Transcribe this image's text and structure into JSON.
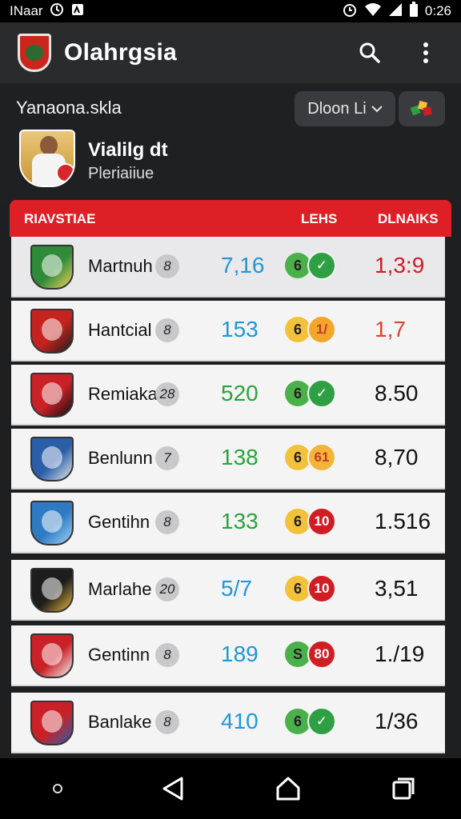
{
  "status_bar": {
    "carrier": "INaar",
    "time": "0:26",
    "icons": [
      "sync-icon",
      "alarm-icon",
      "wifi-icon",
      "signal-icon",
      "battery-icon"
    ]
  },
  "app_bar": {
    "title": "Olahrgsia",
    "icons": [
      "search-icon",
      "more-vert-icon"
    ]
  },
  "subheader": {
    "title": "Yanaona.skla",
    "dropdown_label": "Dloon Li",
    "player_name": "Vialilg dt",
    "player_subtitle": "Pleriaiiue"
  },
  "table": {
    "headers": [
      "RIAVSTIAE",
      "LEHS",
      "DLNAIKS"
    ],
    "rows": [
      {
        "team": "Martnuh",
        "rank": "8",
        "score": "7,16",
        "score_color": "#2196d8",
        "dot_a": "6",
        "dot_a_color": "#49b04a",
        "dot_b": "✓",
        "dot_b_color": "#2ea043",
        "result": "1,3:9",
        "result_color": "#d01d24",
        "crest": [
          "#2f8a39",
          "#f0d25a"
        ]
      },
      {
        "team": "Hantcial",
        "rank": "8",
        "score": "153",
        "score_color": "#2196d8",
        "dot_a": "6",
        "dot_a_color": "#f3c13a",
        "dot_b": "1/",
        "dot_b_color": "#f3a72a",
        "result": "1,7",
        "result_color": "#e0442b",
        "crest": [
          "#c5231f",
          "#1d1d1d"
        ]
      },
      {
        "team": "Remiaka",
        "rank": "28",
        "score": "520",
        "score_color": "#2aa33a",
        "dot_a": "6",
        "dot_a_color": "#49b04a",
        "dot_b": "✓",
        "dot_b_color": "#2ea043",
        "result": "8.50",
        "result_color": "#111111",
        "crest": [
          "#c92127",
          "#111111"
        ]
      },
      {
        "team": "Benlunn",
        "rank": "7",
        "score": "138",
        "score_color": "#2aa33a",
        "dot_a": "6",
        "dot_a_color": "#f3c13a",
        "dot_b": "61",
        "dot_b_color": "#f3b43a",
        "result": "8,70",
        "result_color": "#111111",
        "crest": [
          "#2a5ea8",
          "#e6e6e6"
        ]
      },
      {
        "team": "Gentihn",
        "rank": "8",
        "score": "133",
        "score_color": "#2aa33a",
        "dot_a": "6",
        "dot_a_color": "#f3c13a",
        "dot_b": "10",
        "dot_b_color": "#d01d24",
        "result": "1.516",
        "result_color": "#111111",
        "crest": [
          "#2e7bc4",
          "#9ed3f3"
        ]
      },
      {
        "team": "Marlahe",
        "rank": "20",
        "score": "5/7",
        "score_color": "#2196d8",
        "dot_a": "6",
        "dot_a_color": "#f3c13a",
        "dot_b": "10",
        "dot_b_color": "#d01d24",
        "result": "3,51",
        "result_color": "#111111",
        "crest": [
          "#1d1d1d",
          "#e8b43a"
        ]
      },
      {
        "team": "Gentinn",
        "rank": "8",
        "score": "189",
        "score_color": "#2196d8",
        "dot_a": "S",
        "dot_a_color": "#49b04a",
        "dot_b": "80",
        "dot_b_color": "#d01d24",
        "result": "1./19",
        "result_color": "#111111",
        "crest": [
          "#c92127",
          "#f2f2f2"
        ]
      },
      {
        "team": "Banlake",
        "rank": "8",
        "score": "410",
        "score_color": "#2196d8",
        "dot_a": "6",
        "dot_a_color": "#49b04a",
        "dot_b": "✓",
        "dot_b_color": "#2ea043",
        "result": "1/36",
        "result_color": "#111111",
        "crest": [
          "#c92127",
          "#2a5ea8"
        ]
      }
    ]
  },
  "nav_bar": {
    "icons": [
      "recents-dot-icon",
      "back-icon",
      "home-icon",
      "overview-icon"
    ]
  },
  "colors": {
    "accent_red": "#dd1f26",
    "app_bar": "#2a2b2d",
    "background": "#1e1f21"
  }
}
